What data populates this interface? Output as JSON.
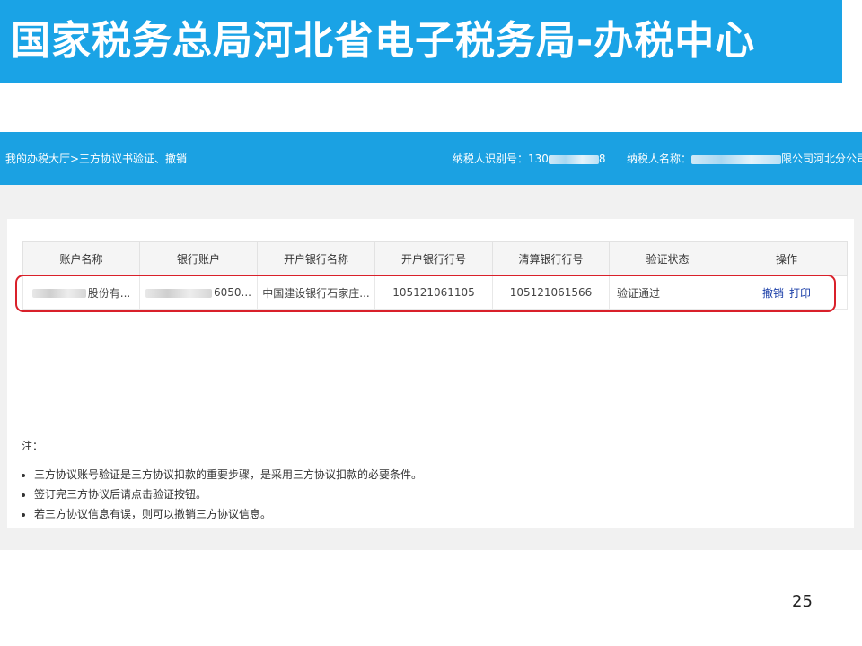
{
  "slide": {
    "title": "国家税务总局河北省电子税务局-办税中心",
    "page_number": "25"
  },
  "header": {
    "breadcrumb": "我的办税大厅>三方协议书验证、撤销",
    "taxpayer_id_label": "纳税人识别号：",
    "taxpayer_id_prefix": "130",
    "taxpayer_id_suffix": "8",
    "taxpayer_name_label": "纳税人名称：",
    "taxpayer_name_suffix": "限公司河北分公司"
  },
  "table": {
    "columns": [
      "账户名称",
      "银行账户",
      "开户银行名称",
      "开户银行行号",
      "清算银行行号",
      "验证状态",
      "操作"
    ],
    "rows": [
      {
        "account_name": "股份有...",
        "bank_account": "6050...",
        "bank_name": "中国建设银行石家庄...",
        "bank_code": "105121061105",
        "clearing_code": "105121061566",
        "status": "验证通过",
        "actions": {
          "revoke": "撤销",
          "print": "打印"
        }
      }
    ]
  },
  "notes": {
    "label": "注：",
    "items": [
      "三方协议账号验证是三方协议扣款的重要步骤，是采用三方协议扣款的必要条件。",
      "签订完三方协议后请点击验证按钮。",
      "若三方协议信息有误，则可以撤销三方协议信息。"
    ]
  },
  "colors": {
    "title_bar": "#1aa3e6",
    "top_bar": "#1ba1e2",
    "highlight_border": "#d9202a",
    "action_link": "#1a3ea8"
  }
}
